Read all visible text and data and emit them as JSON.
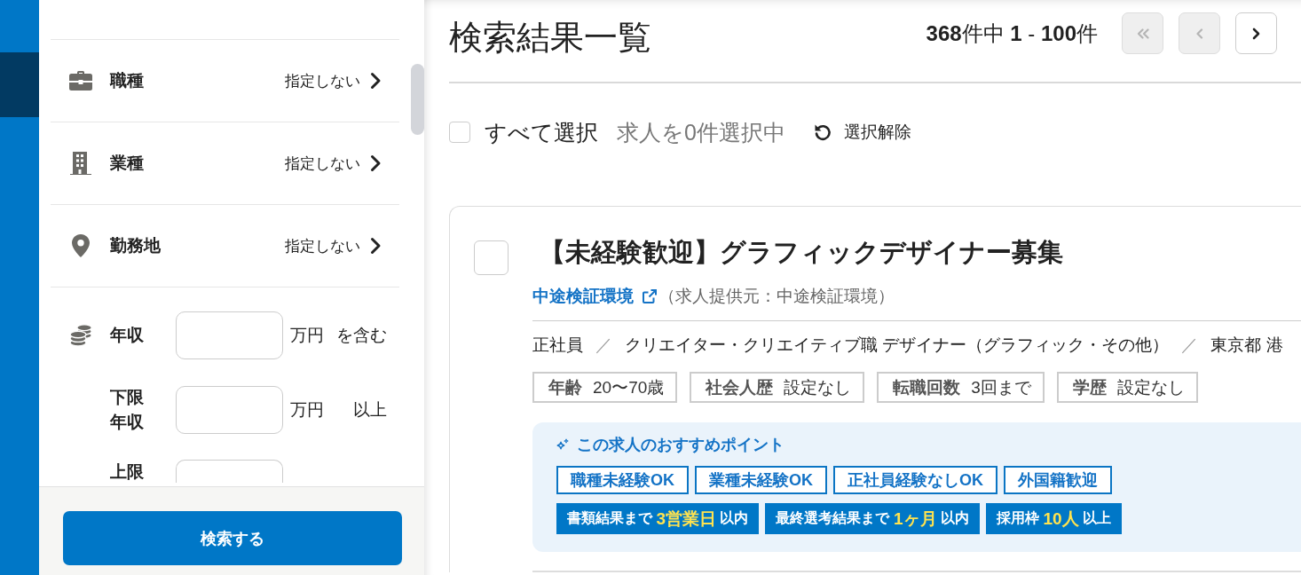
{
  "rail": {
    "tabs": [
      {
        "selected": false
      },
      {
        "selected": true
      }
    ]
  },
  "filters": [
    {
      "label": "職種",
      "value": "指定しない"
    },
    {
      "label": "業種",
      "value": "指定しない"
    },
    {
      "label": "勤務地",
      "value": "指定しない"
    }
  ],
  "salary": [
    {
      "label": "年収",
      "unit": "万円",
      "suffix": "を含む"
    },
    {
      "label": "下限年収",
      "unit": "万円",
      "suffix": "以上"
    },
    {
      "label": "上限"
    }
  ],
  "search_button": "検索する",
  "header": {
    "title": "検索結果一覧",
    "count": "**368**件中 **1** - **100**件"
  },
  "pagination": [
    {
      "kind": "first",
      "disabled": true
    },
    {
      "kind": "prev",
      "disabled": true
    },
    {
      "kind": "next",
      "disabled": false
    }
  ],
  "selection": {
    "label": "すべて選択",
    "checked": false,
    "status": "求人を0件選択中",
    "clear": "選択解除"
  },
  "jobs": [
    {
      "checked": false,
      "title": "【未経験歓迎】グラフィックデザイナー募集",
      "company": "中途検証環境",
      "provider": "（求人提供元：中途検証環境）",
      "details": [
        {
          "kind": "item",
          "text": "正社員"
        },
        {
          "kind": "separator",
          "text": "／"
        },
        {
          "kind": "item",
          "text": "クリエイター・クリエイティブ職 デザイナー（グラフィック・その他）"
        },
        {
          "kind": "separator",
          "text": "／"
        },
        {
          "kind": "item",
          "text": "東京都 港"
        }
      ],
      "requirements": [
        {
          "label": "年齢",
          "value": "20〜70歳"
        },
        {
          "label": "社会人歴",
          "value": "設定なし"
        },
        {
          "label": "転職回数",
          "value": "3回まで"
        },
        {
          "label": "学歴",
          "value": "設定なし"
        }
      ],
      "recommend": {
        "heading": "この求人のおすすめポイント",
        "tags": [
          "職種未経験OK",
          "業種未経験OK",
          "正社員経験なしOK",
          "外国籍歓迎"
        ],
        "highlights": [
          "書類結果まで **3営業日** 以内",
          "最終選考結果まで **1ヶ月** 以内",
          "採用枠 **10人** 以上"
        ]
      }
    }
  ]
}
